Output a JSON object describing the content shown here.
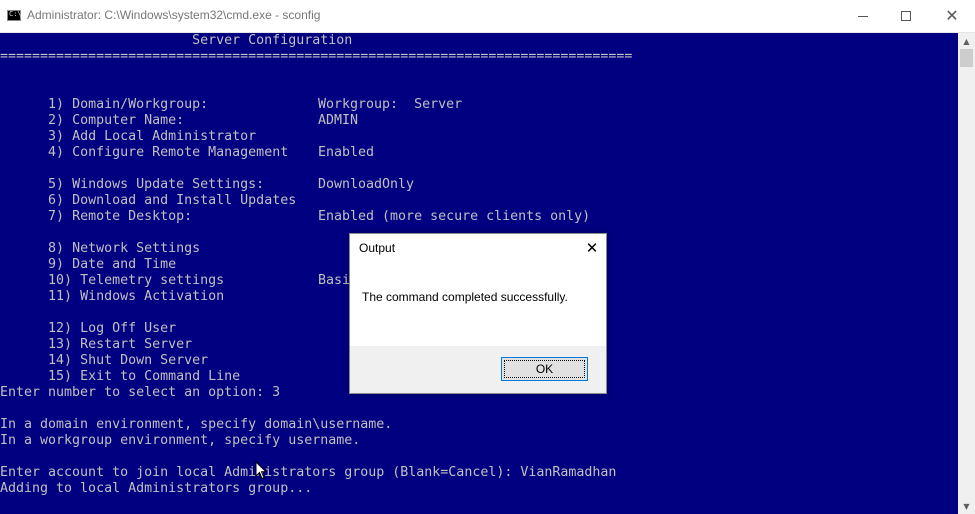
{
  "window": {
    "title": "Administrator: C:\\Windows\\system32\\cmd.exe - sconfig",
    "icon": "cmd-icon"
  },
  "console": {
    "background": "#000080",
    "text_color": "#c0c0c0",
    "heading": "                        Server Configuration",
    "separator": "===============================================================================",
    "menu": [
      {
        "label": "1) Domain/Workgroup:",
        "value": "Workgroup:  Server"
      },
      {
        "label": "2) Computer Name:",
        "value": "ADMIN"
      },
      {
        "label": "3) Add Local Administrator",
        "value": ""
      },
      {
        "label": "4) Configure Remote Management",
        "value": "Enabled"
      },
      {
        "label": "5) Windows Update Settings:",
        "value": "DownloadOnly"
      },
      {
        "label": "6) Download and Install Updates",
        "value": ""
      },
      {
        "label": "7) Remote Desktop:",
        "value": "Enabled (more secure clients only)"
      },
      {
        "label": "8) Network Settings",
        "value": ""
      },
      {
        "label": "9) Date and Time",
        "value": ""
      },
      {
        "label": "10) Telemetry settings",
        "value": "Basic"
      },
      {
        "label": "11) Windows Activation",
        "value": ""
      },
      {
        "label": "12) Log Off User",
        "value": ""
      },
      {
        "label": "13) Restart Server",
        "value": ""
      },
      {
        "label": "14) Shut Down Server",
        "value": ""
      },
      {
        "label": "15) Exit to Command Line",
        "value": ""
      }
    ],
    "prompt": "Enter number to select an option: 3",
    "info_domain": "In a domain environment, specify domain\\username.",
    "info_workgroup": "In a workgroup environment, specify username.",
    "account_prompt": "Enter account to join local Administrators group (Blank=Cancel): VianRamadhan",
    "status": "Adding to local Administrators group..."
  },
  "dialog": {
    "title": "Output",
    "message": "The command completed successfully.",
    "ok_label": "OK",
    "accent": "#0078d7"
  }
}
